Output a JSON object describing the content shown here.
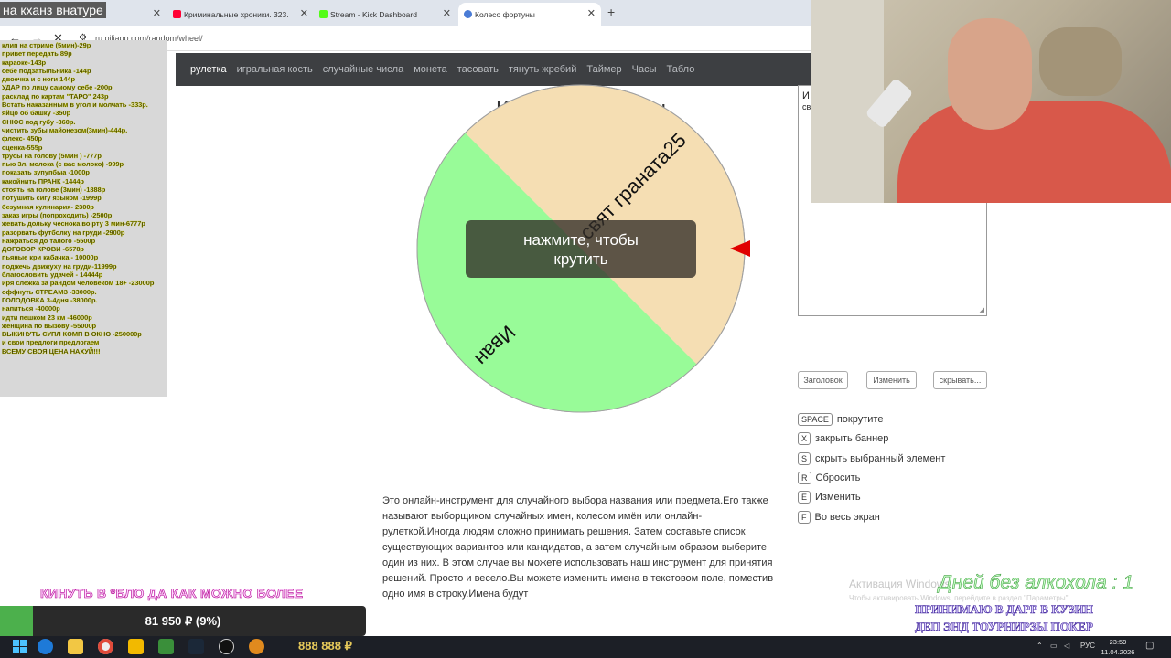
{
  "stream_title": "на кханз внатуре",
  "tabs": [
    {
      "label": "",
      "color": "#ffffff"
    },
    {
      "label": "Криминальные хроники. 323.",
      "color": "#ff0033"
    },
    {
      "label": "Stream - Kick Dashboard",
      "color": "#53fc18"
    },
    {
      "label": "Колесо фортуны",
      "color": "#4a7cd6"
    }
  ],
  "url": "ru.piliapp.com/random/wheel/",
  "site_nav": [
    "рулетка",
    "игральная кость",
    "случайные числа",
    "монета",
    "тасовать",
    "тянуть жребий",
    "Таймер",
    "Часы",
    "Табло"
  ],
  "heading": "Колесо фортуны",
  "wheel": {
    "segments": [
      {
        "label": "свят граната25",
        "color": "#f5deb3"
      },
      {
        "label": "Иван",
        "color": "#98fb98"
      }
    ],
    "spin_label": "нажмите, чтобы крутить",
    "pointer_color": "#e00000"
  },
  "textarea_partial": [
    "И",
    "св"
  ],
  "buttons": [
    "Заголовок",
    "Изменить",
    "скрывать..."
  ],
  "shortcuts": [
    {
      "key": "SPACE",
      "label": "покрутите"
    },
    {
      "key": "X",
      "label": "закрыть баннер"
    },
    {
      "key": "S",
      "label": "скрыть выбранный элемент"
    },
    {
      "key": "R",
      "label": "Сбросить"
    },
    {
      "key": "E",
      "label": "Изменить"
    },
    {
      "key": "F",
      "label": "Во весь экран"
    }
  ],
  "description": "Это онлайн-инструмент для случайного выбора названия или предмета.Его также называют выборщиком случайных имен, колесом имён или онлайн-рулеткой.Иногда людям сложно принимать решения. Затем составьте список существующих вариантов или кандидатов, а затем случайным образом выберите один из них. В этом случае вы можете использовать наш инструмент для принятия решений. Просто и весело.Вы можете изменить имена в текстовом поле, поместив одно имя в строку.Имена будут",
  "donate_menu": [
    "клип на стриме (5мин)-29р",
    "привет передать 89р",
    "караоке-143р",
    "себе подзатыльника -144р",
    "двоечка и с ноги 144р",
    "УДАР по лицу самому себе -200р",
    "расклад по картам \"ТАРО\" 243р",
    "Встать наказанным в угол и молчать -333р.",
    "яйцо об башку -350р",
    "СНЮС под губу -360р.",
    "чистить зубы майонезом(3мин)-444р.",
    "флекс- 450р",
    "сценка-555р",
    "трусы на голову (5мин ) -777р",
    "пью 3л. молока (с вас молоко) -999р",
    "показать зупупбыа -1000р",
    "какойнить ПРАНК -1444р",
    "стоять на голове (3мин) -1888р",
    "потушить сигу языком -1999р",
    "безумная кулинария- 2300р",
    "заказ игры (попроходить) -2500р",
    "жевать дольку чеснока во рту 3 мин-6777р",
    "разорвать футболку на груди -2900р",
    "нажраться до талого -5500р",
    "ДОГОВОР КРОВИ -6578р",
    "пьяные кри кабачка - 10000р",
    "поджечь движуху на груди-11999р",
    "благословить удачей - 14444р",
    "иря слежка за рандом человеком 18+ -23000р",
    "оффнуть СТРЕАМЗ -33000р.",
    "ГОЛОДОВКА 3-4дня -38000р.",
    "напиться -40000р",
    "идти пешком 23 км -46000р",
    "женщина по вызову -55000р",
    "ВЫКИНУТЬ СУПЛ КОМП В ОКНО -250000р",
    "и свои предлоги предлогаем",
    "ВСЕМУ СВОЯ ЦЕНА НАХУЙ!!!"
  ],
  "goal": {
    "label": "КИНУТЬ В *БЛО ДА КАК МОЖНО БОЛЕЕ",
    "text": "81 950 ₽ (9%)",
    "percent": 9,
    "fill_color": "#4cb04c"
  },
  "activation": {
    "title": "Активация Windows",
    "subtitle": "Чтобы активировать Windows, перейдите в раздел \"Параметры\"."
  },
  "days_counter": "Дней  без  алкохола : 1",
  "promo_lines": [
    "ПРИНИМАЮ В ДАРР В КУЗИН",
    "ДЕП ЭНД ТОУРНИРЗЫ ПОКЕР"
  ],
  "taskbar": {
    "money": "888 888 ₽",
    "lang": "РУС",
    "time": "23:59",
    "date": "11.04.2026"
  }
}
